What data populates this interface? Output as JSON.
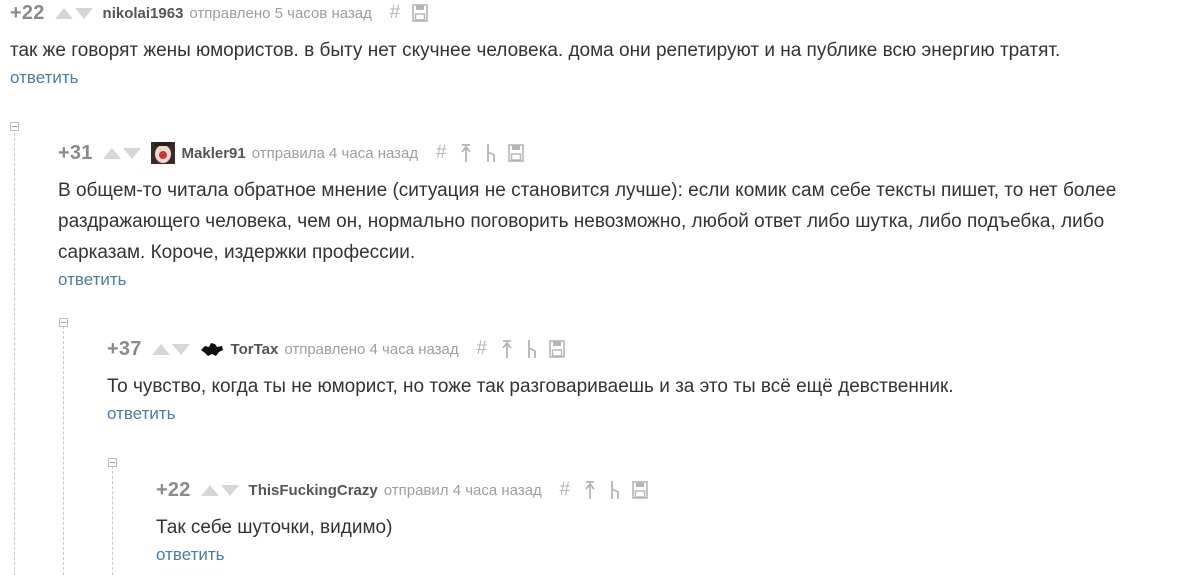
{
  "comments": [
    {
      "rating": "+22",
      "author": "nikolai1963",
      "sent": "отправлено 5 часов назад",
      "text": "так же говорят жены юмористов. в быту нет скучнее человека. дома они репетируют и на публике всю энергию тратят.",
      "reply": "ответить",
      "icons": [
        "hash-icon",
        "save-icon"
      ]
    },
    {
      "rating": "+31",
      "author": "Makler91",
      "sent": "отправила 4 часа назад",
      "text": "В общем-то читала обратное мнение (ситуация не становится лучше): если комик сам себе тексты пишет, то нет более раздражающего человека, чем он, нормально поговорить невозможно, любой ответ либо шутка, либо подъебка, либо сарказам. Короче, издержки профессии.",
      "reply": "ответить",
      "icons": [
        "hash-icon",
        "arrow-up-icon",
        "branch-icon",
        "save-icon"
      ]
    },
    {
      "rating": "+37",
      "author": "TorTax",
      "sent": "отправлено 4 часа назад",
      "text": "То чувство, когда ты не юморист, но тоже так разговариваешь и за это ты всё ещё девственник.",
      "reply": "ответить",
      "icons": [
        "hash-icon",
        "arrow-up-icon",
        "branch-icon",
        "save-icon"
      ]
    },
    {
      "rating": "+22",
      "author": "ThisFuckingCrazy",
      "sent": "отправил 4 часа назад",
      "text": "Так себе шуточки, видимо)",
      "reply": "ответить",
      "icons": [
        "hash-icon",
        "arrow-up-icon",
        "branch-icon",
        "save-icon"
      ]
    }
  ],
  "colors": {
    "reply_link": "#4a7ca7",
    "rating": "#8a8a8a",
    "meta": "#9e9e9e",
    "vote_arrow": "#d6d6d6"
  }
}
